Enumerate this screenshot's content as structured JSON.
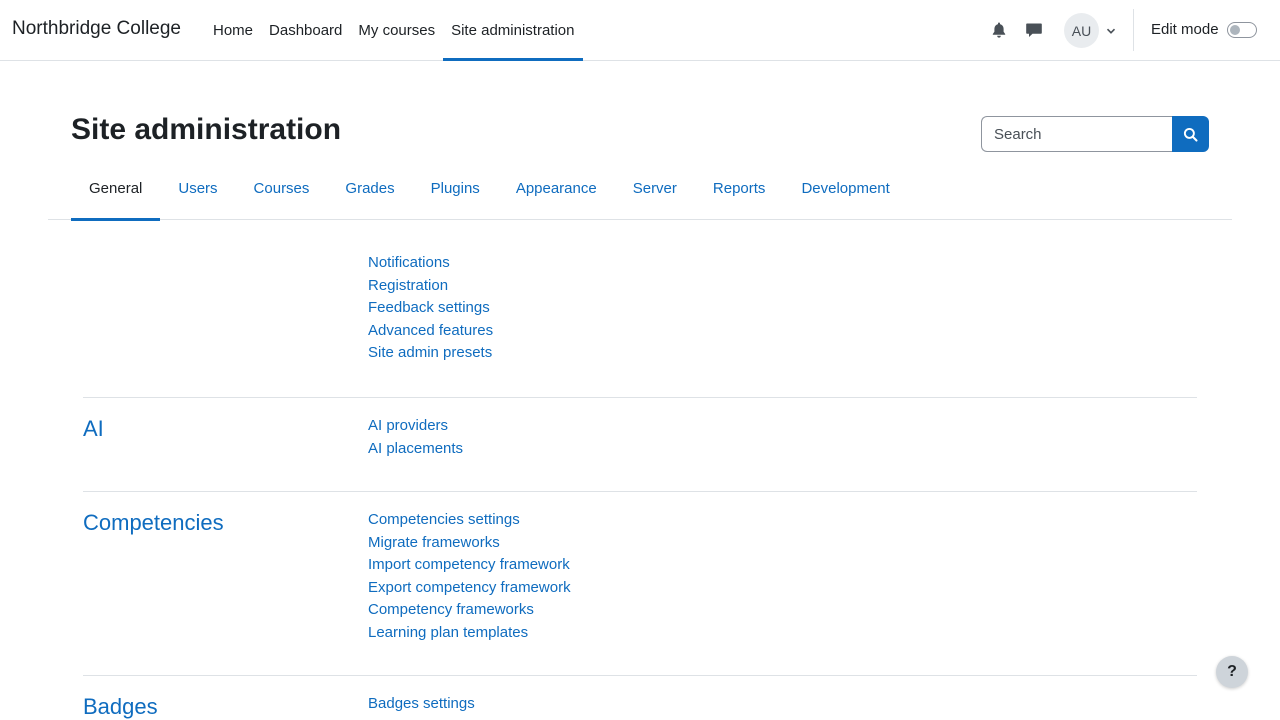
{
  "site": {
    "name": "Northbridge College"
  },
  "primary_nav": [
    {
      "label": "Home"
    },
    {
      "label": "Dashboard"
    },
    {
      "label": "My courses"
    },
    {
      "label": "Site administration",
      "active": true
    }
  ],
  "user_menu": {
    "initials": "AU"
  },
  "edit_mode": {
    "label": "Edit mode",
    "enabled": false
  },
  "page": {
    "title": "Site administration"
  },
  "search": {
    "placeholder": "Search",
    "value": ""
  },
  "tabs": [
    {
      "label": "General",
      "active": true
    },
    {
      "label": "Users"
    },
    {
      "label": "Courses"
    },
    {
      "label": "Grades"
    },
    {
      "label": "Plugins"
    },
    {
      "label": "Appearance"
    },
    {
      "label": "Server"
    },
    {
      "label": "Reports"
    },
    {
      "label": "Development"
    }
  ],
  "sections": [
    {
      "title": "",
      "links": [
        "Notifications",
        "Registration",
        "Feedback settings",
        "Advanced features",
        "Site admin presets"
      ]
    },
    {
      "title": "AI",
      "links": [
        "AI providers",
        "AI placements"
      ]
    },
    {
      "title": "Competencies",
      "links": [
        "Competencies settings",
        "Migrate frameworks",
        "Import competency framework",
        "Export competency framework",
        "Competency frameworks",
        "Learning plan templates"
      ]
    },
    {
      "title": "Badges",
      "links": [
        "Badges settings"
      ]
    }
  ],
  "help": {
    "label": "?"
  },
  "colors": {
    "link": "#0f6cbf",
    "text": "#1d2125",
    "border": "#dee2e6"
  },
  "icons": {
    "notifications": "bell-icon",
    "messages": "chat-icon",
    "user_menu_caret": "chevron-down-icon",
    "search": "search-icon"
  }
}
